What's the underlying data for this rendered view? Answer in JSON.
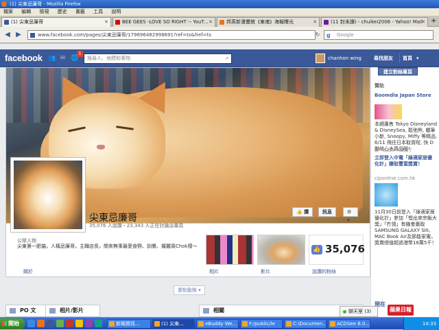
{
  "window": {
    "title": "(1) 尖東忌廉哥 - Mozilla Firefox"
  },
  "menu": [
    "檔案",
    "編輯",
    "檢視",
    "歷史",
    "書籤",
    "工具",
    "說明"
  ],
  "tabs": [
    {
      "label": "(1) 尖東忌廉哥",
      "color": "#3b5998"
    },
    {
      "label": "BEE GEES -LOVE SO RIGHT -- YouT...",
      "color": "#cc1111"
    },
    {
      "label": "邦英新漫畫館《東魂》海報曝光",
      "color": "#e8731a"
    },
    {
      "label": "(11 封未讀) - chuikei2006 - Yahoo! Mail",
      "color": "#6a1b9a"
    }
  ],
  "address_bar": {
    "url": "www.facebook.com/pages/尖東忌廉哥/179696482998691?ref=ts&fref=ts"
  },
  "search_bar": {
    "placeholder": "Google"
  },
  "facebook": {
    "logo": "facebook",
    "notification_count": "1",
    "search_placeholder": "搜尋人、地標和事物",
    "user_name": "chanhon wing",
    "find_friends": "尋找朋友",
    "home": "首頁",
    "home_caret": "▾"
  },
  "page": {
    "name": "尖東忌廉哥",
    "stats": "35,076 人說讚・23,343 人正在討論這專頁",
    "like_button": "讚",
    "message_button": "訊息",
    "settings_button": "⚙ ▾",
    "about_label": "公眾人物",
    "about_text": "尖東第一肥貓，人稱忌廉哥，主職店長，閒來無事最愛食野、訓覺、攞麗周Chok樣～",
    "tabs": [
      "關於",
      "相片",
      "影片",
      "說讚的粉絲"
    ],
    "likes_count": "35,076",
    "highlights_link": "重點動態 ▾",
    "lower_boxes": [
      "PO 文",
      "相片/影片",
      "相關"
    ]
  },
  "sidebar": {
    "create_group": "建立粉絲專頁",
    "sponsored": "贊助",
    "ad1": {
      "title": "Boomdia Japan Store",
      "text": "本網專售 Tokyo Disneyland & DisneySea, 鬆弛熊, 蠟筆小新, Snoopy, Miffy 等精品. 6/11 飛往日本取貨啦, 快 D 聯絡心水貨品啦!",
      "likes": "讚・8,229 人說讚了"
    },
    "ad2": {
      "title": "立即登入中電「綠適家居優化計」賺取豐富獎賞！",
      "link": "clponline.com.hk",
      "text": "11月30日前登入「綠適家居優化計」參加「慳出來宗飯大獎」「冇領」有機會贏取SAMSUNG GALAXY SIII、MAC Book Air及節能家電，獎賞總值超過港幣16萬5千！"
    },
    "now_label": "現在",
    "chat": "聊天室 (3)",
    "watermark": "蘋果日報"
  },
  "taskbar": {
    "start": "開始",
    "tasks": [
      "新聞資訊...",
      "(1) 尖東...",
      "eBuddy We...",
      "F:/public/le",
      "C:\\Documen...",
      "ACDSee 6.0..."
    ],
    "clock": "14:33"
  }
}
